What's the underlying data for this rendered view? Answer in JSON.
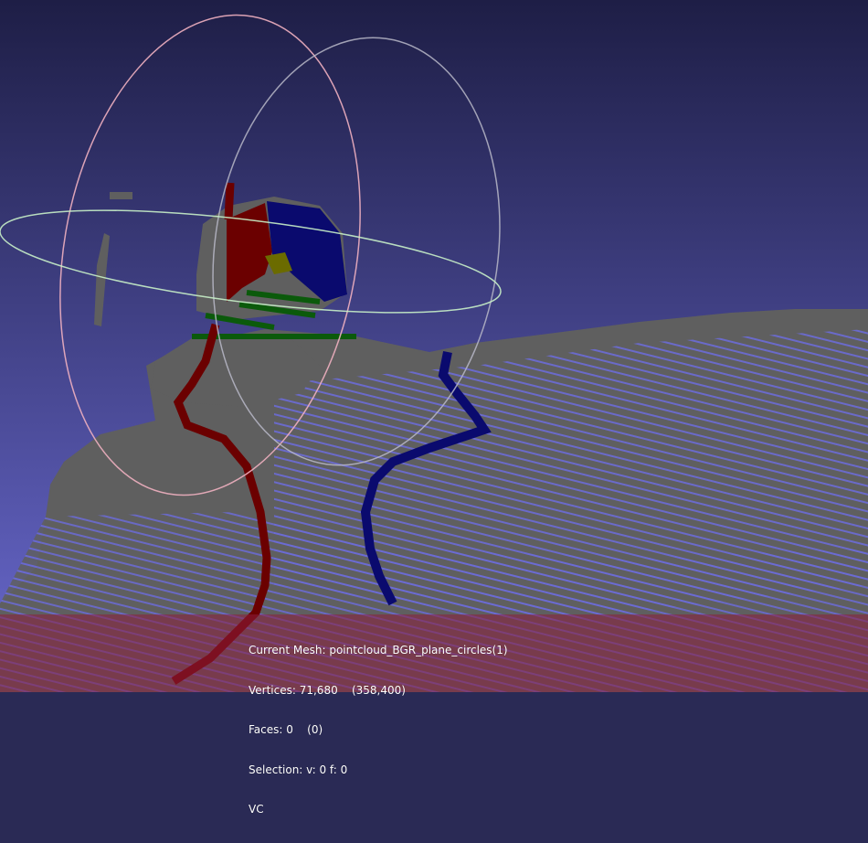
{
  "viewport": {
    "background_top": "#1e1e46",
    "background_bottom": "#6a6ad0",
    "point_color": "#5f5f5f",
    "shadow_color": "#6b6bd6",
    "stroke_colors": {
      "red": "#6b0000",
      "blue": "#0a0a6e",
      "green": "#0b5a0b",
      "yellow": "#6b6b00"
    },
    "trackball_colors": {
      "ring_vertical": "#f0b0c0",
      "ring_side": "#b8b8c8",
      "ring_horizontal": "#c8f0c8"
    }
  },
  "info": {
    "overlay_color": "#8c1e3c",
    "current_mesh": "Current Mesh: pointcloud_BGR_plane_circles(1)",
    "vertices": "Vertices: 71,680    (358,400)",
    "faces": "Faces: 0    (0)",
    "selection": "Selection: v: 0 f: 0",
    "mode": "VC"
  }
}
